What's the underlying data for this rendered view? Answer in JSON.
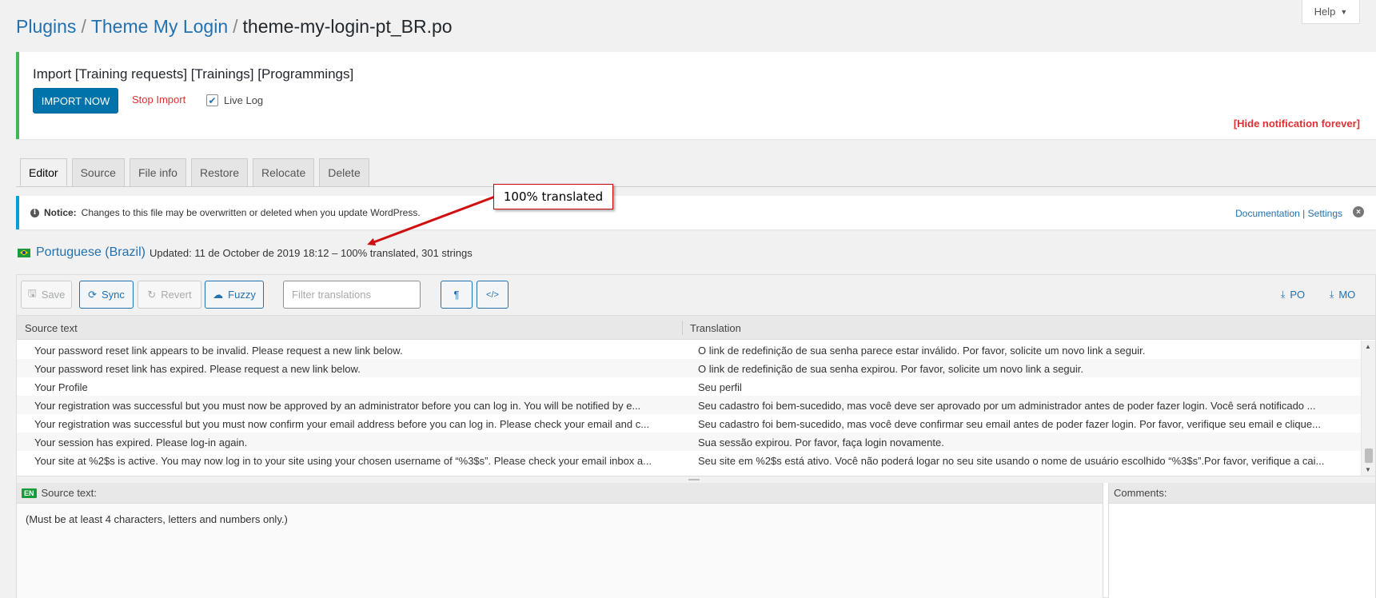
{
  "help": {
    "label": "Help",
    "caret": "▼"
  },
  "breadcrumb": {
    "items": [
      "Plugins",
      "Theme My Login"
    ],
    "current": "theme-my-login-pt_BR.po",
    "separator": "/"
  },
  "import_notice": {
    "title": "Import [Training requests] [Trainings] [Programmings]",
    "import_button": "IMPORT NOW",
    "stop_link": "Stop Import",
    "live_log": "Live Log",
    "live_log_checked": true,
    "hide_link": "[Hide notification forever]"
  },
  "tabs": [
    {
      "label": "Editor",
      "active": true
    },
    {
      "label": "Source",
      "active": false
    },
    {
      "label": "File info",
      "active": false
    },
    {
      "label": "Restore",
      "active": false
    },
    {
      "label": "Relocate",
      "active": false
    },
    {
      "label": "Delete",
      "active": false
    }
  ],
  "notice": {
    "label": "Notice:",
    "text": "Changes to this file may be overwritten or deleted when you update WordPress.",
    "documentation": "Documentation",
    "divider": "|",
    "settings": "Settings"
  },
  "callout": {
    "text": "100% translated"
  },
  "language": {
    "name": "Portuguese (Brazil)",
    "updated": "Updated: 11 de October de 2019 18:12 – 100% translated, 301 strings"
  },
  "toolbar": {
    "save": "Save",
    "sync": "Sync",
    "revert": "Revert",
    "fuzzy": "Fuzzy",
    "filter_placeholder": "Filter translations",
    "pilcrow": "¶",
    "code": "</>",
    "po": "PO",
    "mo": "MO"
  },
  "grid": {
    "col_source": "Source text",
    "col_translation": "Translation",
    "rows": [
      {
        "source": "Your password reset link appears to be invalid. Please request a new link below.",
        "translation": "O link de redefinição de sua senha parece estar inválido. Por favor, solicite um novo link a seguir."
      },
      {
        "source": "Your password reset link has expired. Please request a new link below.",
        "translation": "O link de redefinição de sua senha expirou. Por favor, solicite um novo link a seguir."
      },
      {
        "source": "Your Profile",
        "translation": "Seu perfil"
      },
      {
        "source": "Your registration was successful but you must now be approved by an administrator before you can log in. You will be notified by e...",
        "translation": "Seu cadastro foi bem-sucedido, mas você deve ser aprovado por um administrador antes de poder fazer login. Você será notificado ..."
      },
      {
        "source": "Your registration was successful but you must now confirm your email address before you can log in. Please check your email and c...",
        "translation": "Seu cadastro foi bem-sucedido, mas você deve confirmar seu email antes de poder fazer login. Por favor, verifique seu email e clique..."
      },
      {
        "source": "Your session has expired. Please log-in again.",
        "translation": "Sua sessão expirou. Por favor, faça login novamente."
      },
      {
        "source": "Your site at %2$s is active. You may now log in to your site using your chosen username of “%3$s”. Please check your email inbox a...",
        "translation": "Seu site em %2$s está ativo. Você não poderá logar no seu site usando o nome de usuário escolhido “%3$s”.Por favor, verifique a cai..."
      }
    ]
  },
  "source_pane": {
    "badge": "EN",
    "label": "Source text:",
    "text": "(Must be at least 4 characters, letters and numbers only.)"
  },
  "comments_pane": {
    "label": "Comments:"
  },
  "colors": {
    "link": "#2271b1",
    "primary": "#0073aa",
    "danger": "#dc3232",
    "success": "#46b450",
    "info": "#00a0d2"
  }
}
